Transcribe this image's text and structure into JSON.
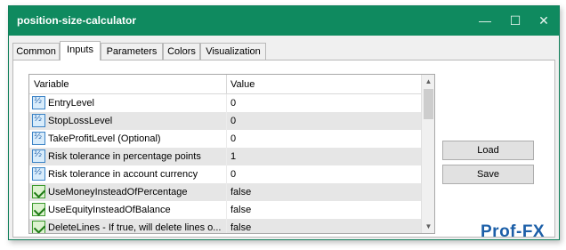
{
  "window": {
    "title": "position-size-calculator"
  },
  "tabs": [
    {
      "label": "Common"
    },
    {
      "label": "Inputs"
    },
    {
      "label": "Parameters"
    },
    {
      "label": "Colors"
    },
    {
      "label": "Visualization"
    }
  ],
  "active_tab": "Inputs",
  "table": {
    "headers": {
      "variable": "Variable",
      "value": "Value"
    },
    "rows": [
      {
        "icon": "numeric-input-icon",
        "name": "EntryLevel",
        "value": "0"
      },
      {
        "icon": "numeric-input-icon",
        "name": "StopLossLevel",
        "value": "0"
      },
      {
        "icon": "numeric-input-icon",
        "name": "TakeProfitLevel (Optional)",
        "value": "0"
      },
      {
        "icon": "numeric-input-icon",
        "name": "Risk tolerance in percentage points",
        "value": "1"
      },
      {
        "icon": "numeric-input-icon",
        "name": "Risk tolerance in account currency",
        "value": "0"
      },
      {
        "icon": "boolean-input-icon",
        "name": "UseMoneyInsteadOfPercentage",
        "value": "false"
      },
      {
        "icon": "boolean-input-icon",
        "name": "UseEquityInsteadOfBalance",
        "value": "false"
      },
      {
        "icon": "boolean-input-icon",
        "name": "DeleteLines - If true, will delete lines o...",
        "value": "false"
      }
    ]
  },
  "buttons": {
    "load": "Load",
    "save": "Save"
  },
  "watermark": {
    "text": "Prof-FX"
  },
  "colors": {
    "titlebar": "#0f8a5f",
    "shaded_row": "#e6e6e6",
    "watermark": "#1c5fa8"
  }
}
